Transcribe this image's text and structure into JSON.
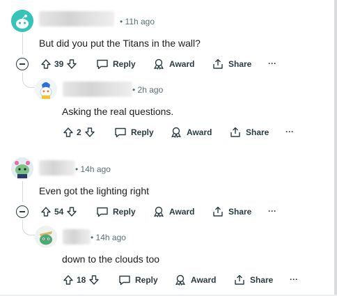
{
  "comments": [
    {
      "time": "11h ago",
      "text": "But did you put the Titans in the wall?",
      "votes": "39",
      "reply_label": "Reply",
      "award_label": "Award",
      "share_label": "Share",
      "more_label": "···"
    },
    {
      "time": "2h ago",
      "text": "Asking the real questions.",
      "votes": "2",
      "reply_label": "Reply",
      "award_label": "Award",
      "share_label": "Share",
      "more_label": "···"
    },
    {
      "time": "14h ago",
      "text": "Even got the lighting right",
      "votes": "54",
      "reply_label": "Reply",
      "award_label": "Award",
      "share_label": "Share",
      "more_label": "···"
    },
    {
      "time": "14h ago",
      "text": "down to the clouds too",
      "votes": "18",
      "reply_label": "Reply",
      "award_label": "Award",
      "share_label": "Share",
      "more_label": "···"
    }
  ],
  "separator": "•",
  "colors": {
    "meta": "#576f76",
    "action": "#2a3c42",
    "thread": "#d5d9db"
  }
}
